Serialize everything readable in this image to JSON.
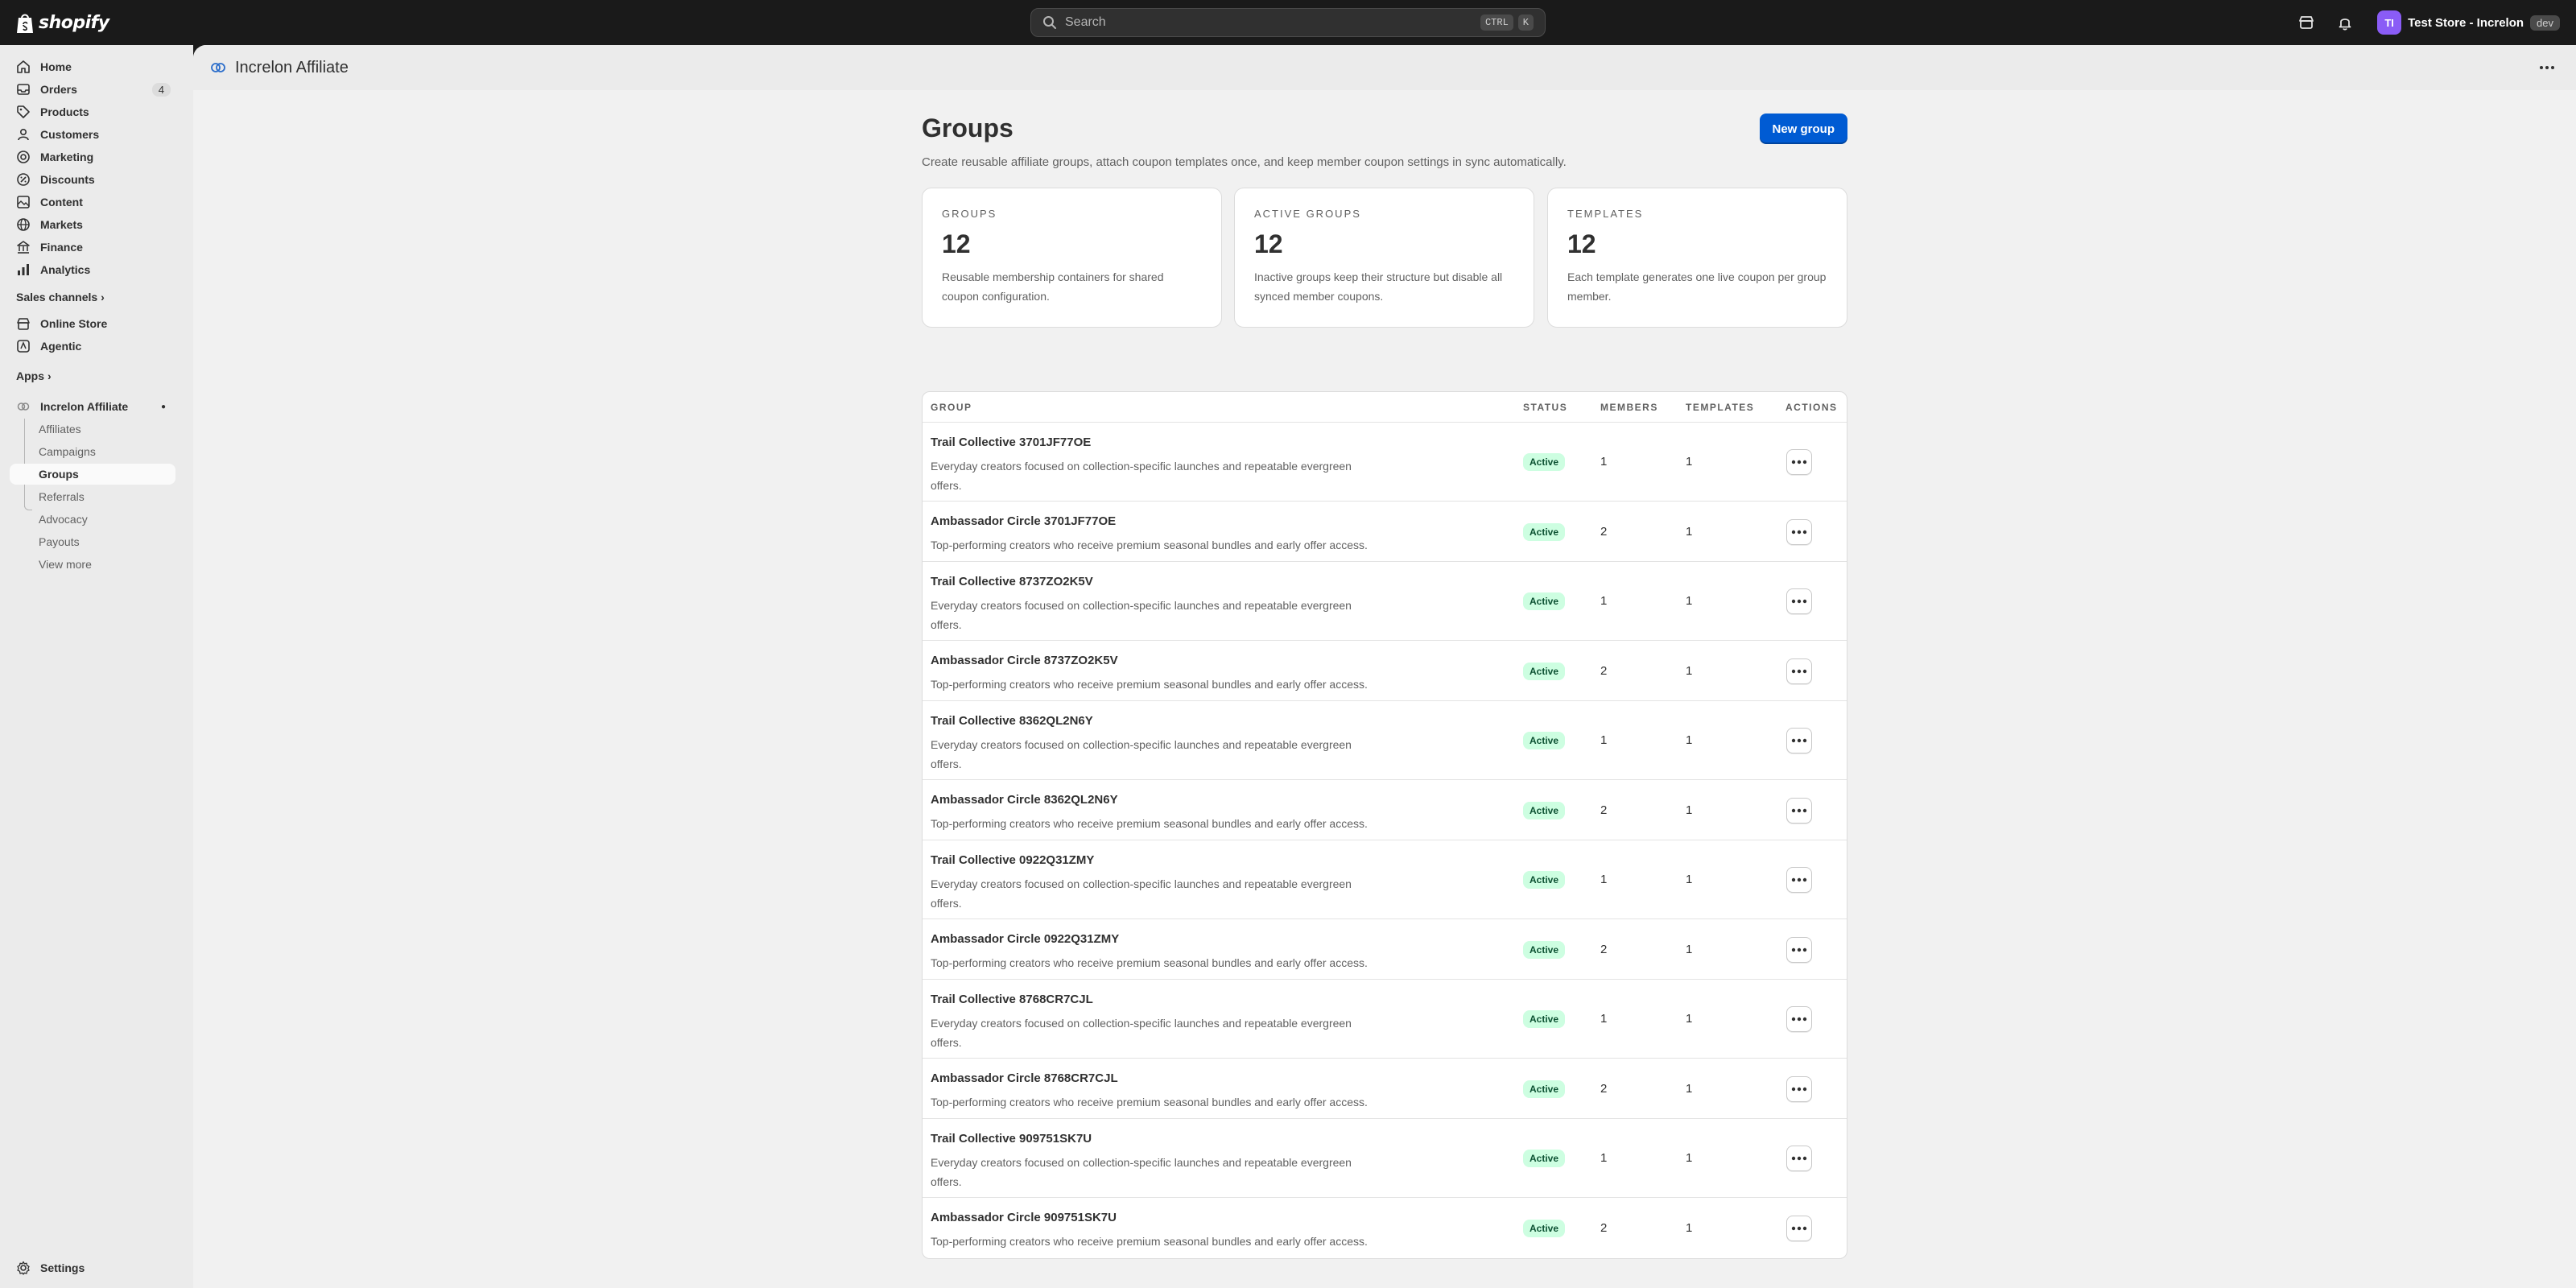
{
  "topbar": {
    "logo_text": "shopify",
    "search_placeholder": "Search",
    "search_kbd_1": "CTRL",
    "search_kbd_2": "K",
    "avatar_initials": "TI",
    "store_name": "Test Store - Increlon",
    "store_badge": "dev"
  },
  "sidebar": {
    "items": [
      {
        "label": "Home",
        "icon": "home-icon"
      },
      {
        "label": "Orders",
        "icon": "orders-icon",
        "count": "4"
      },
      {
        "label": "Products",
        "icon": "tag-icon"
      },
      {
        "label": "Customers",
        "icon": "person-icon"
      },
      {
        "label": "Marketing",
        "icon": "target-icon"
      },
      {
        "label": "Discounts",
        "icon": "discount-icon"
      },
      {
        "label": "Content",
        "icon": "content-icon"
      },
      {
        "label": "Markets",
        "icon": "globe-icon"
      },
      {
        "label": "Finance",
        "icon": "bank-icon"
      },
      {
        "label": "Analytics",
        "icon": "chart-icon"
      }
    ],
    "sales_channels_label": "Sales channels",
    "channels": [
      {
        "label": "Online Store",
        "icon": "store-icon"
      },
      {
        "label": "Agentic",
        "icon": "agentic-icon"
      }
    ],
    "apps_label": "Apps",
    "app_name": "Increlon Affiliate",
    "app_subitems": [
      "Affiliates",
      "Campaigns",
      "Groups",
      "Referrals",
      "Advocacy",
      "Payouts",
      "View more"
    ],
    "settings_label": "Settings"
  },
  "app_header": {
    "title": "Increlon Affiliate"
  },
  "page": {
    "title": "Groups",
    "subtitle": "Create reusable affiliate groups, attach coupon templates once, and keep member coupon settings in sync automatically.",
    "new_button": "New group"
  },
  "stats": [
    {
      "label": "GROUPS",
      "value": "12",
      "desc": "Reusable membership containers for shared coupon configuration."
    },
    {
      "label": "ACTIVE GROUPS",
      "value": "12",
      "desc": "Inactive groups keep their structure but disable all synced member coupons."
    },
    {
      "label": "TEMPLATES",
      "value": "12",
      "desc": "Each template generates one live coupon per group member."
    }
  ],
  "table": {
    "headers": {
      "group": "GROUP",
      "status": "STATUS",
      "members": "MEMBERS",
      "templates": "TEMPLATES",
      "actions": "ACTIONS"
    },
    "rows": [
      {
        "name": "Trail Collective 3701JF77OE",
        "desc": "Everyday creators focused on collection-specific launches and repeatable evergreen offers.",
        "status": "Active",
        "members": "1",
        "templates": "1"
      },
      {
        "name": "Ambassador Circle 3701JF77OE",
        "desc": "Top-performing creators who receive premium seasonal bundles and early offer access.",
        "status": "Active",
        "members": "2",
        "templates": "1"
      },
      {
        "name": "Trail Collective 8737ZO2K5V",
        "desc": "Everyday creators focused on collection-specific launches and repeatable evergreen offers.",
        "status": "Active",
        "members": "1",
        "templates": "1"
      },
      {
        "name": "Ambassador Circle 8737ZO2K5V",
        "desc": "Top-performing creators who receive premium seasonal bundles and early offer access.",
        "status": "Active",
        "members": "2",
        "templates": "1"
      },
      {
        "name": "Trail Collective 8362QL2N6Y",
        "desc": "Everyday creators focused on collection-specific launches and repeatable evergreen offers.",
        "status": "Active",
        "members": "1",
        "templates": "1"
      },
      {
        "name": "Ambassador Circle 8362QL2N6Y",
        "desc": "Top-performing creators who receive premium seasonal bundles and early offer access.",
        "status": "Active",
        "members": "2",
        "templates": "1"
      },
      {
        "name": "Trail Collective 0922Q31ZMY",
        "desc": "Everyday creators focused on collection-specific launches and repeatable evergreen offers.",
        "status": "Active",
        "members": "1",
        "templates": "1"
      },
      {
        "name": "Ambassador Circle 0922Q31ZMY",
        "desc": "Top-performing creators who receive premium seasonal bundles and early offer access.",
        "status": "Active",
        "members": "2",
        "templates": "1"
      },
      {
        "name": "Trail Collective 8768CR7CJL",
        "desc": "Everyday creators focused on collection-specific launches and repeatable evergreen offers.",
        "status": "Active",
        "members": "1",
        "templates": "1"
      },
      {
        "name": "Ambassador Circle 8768CR7CJL",
        "desc": "Top-performing creators who receive premium seasonal bundles and early offer access.",
        "status": "Active",
        "members": "2",
        "templates": "1"
      },
      {
        "name": "Trail Collective 909751SK7U",
        "desc": "Everyday creators focused on collection-specific launches and repeatable evergreen offers.",
        "status": "Active",
        "members": "1",
        "templates": "1"
      },
      {
        "name": "Ambassador Circle 909751SK7U",
        "desc": "Top-performing creators who receive premium seasonal bundles and early offer access.",
        "status": "Active",
        "members": "2",
        "templates": "1"
      }
    ]
  },
  "colors": {
    "primary": "#005bd3",
    "badge_bg": "#cdfee1",
    "badge_text": "#0c5132",
    "topbar": "#1a1a1a"
  }
}
